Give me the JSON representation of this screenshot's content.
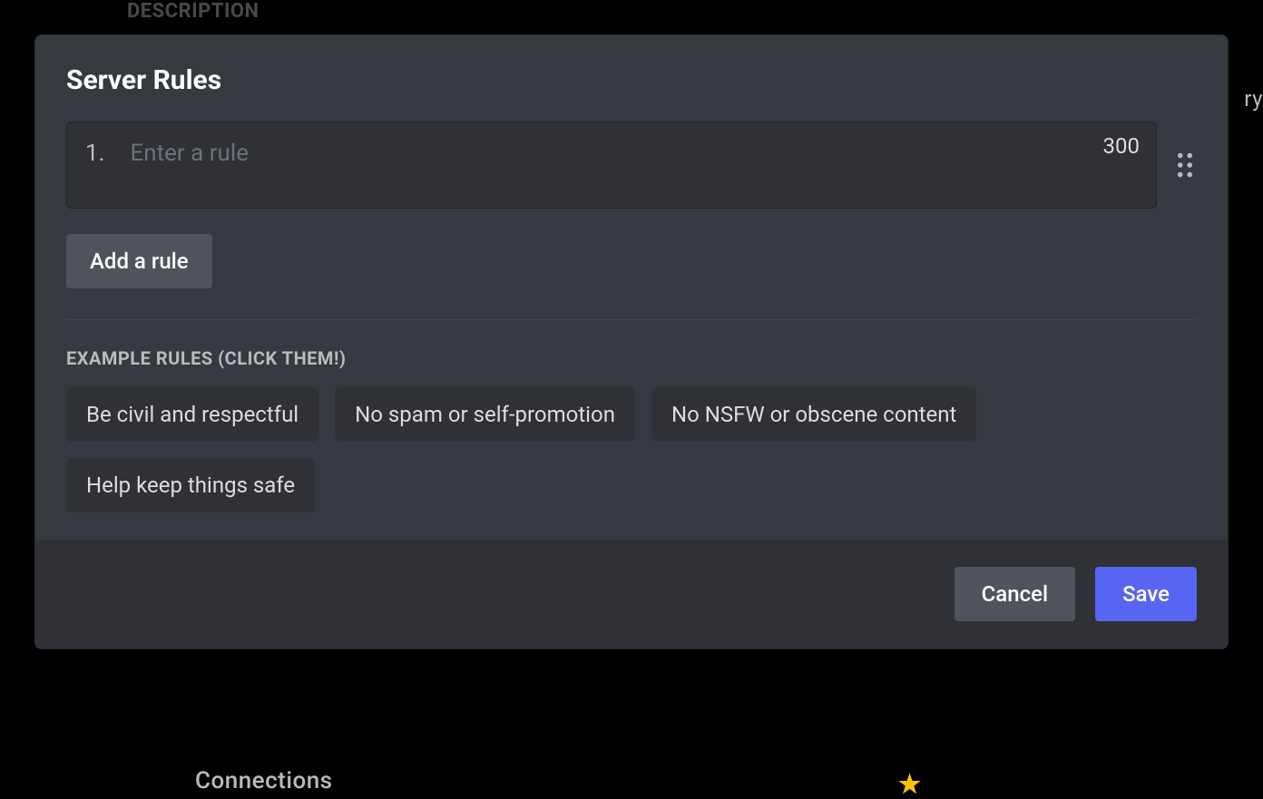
{
  "backdrop": {
    "description_label": "DESCRIPTION",
    "connections_label": "Connections",
    "partial_right": "ry"
  },
  "modal": {
    "title": "Server Rules",
    "rule": {
      "number": "1.",
      "placeholder": "Enter a rule",
      "char_limit": "300",
      "value": ""
    },
    "add_rule_label": "Add a rule",
    "example_heading": "Example Rules (click them!)",
    "example_rules": [
      "Be civil and respectful",
      "No spam or self-promotion",
      "No NSFW or obscene content",
      "Help keep things safe"
    ],
    "footer": {
      "cancel_label": "Cancel",
      "save_label": "Save"
    }
  }
}
